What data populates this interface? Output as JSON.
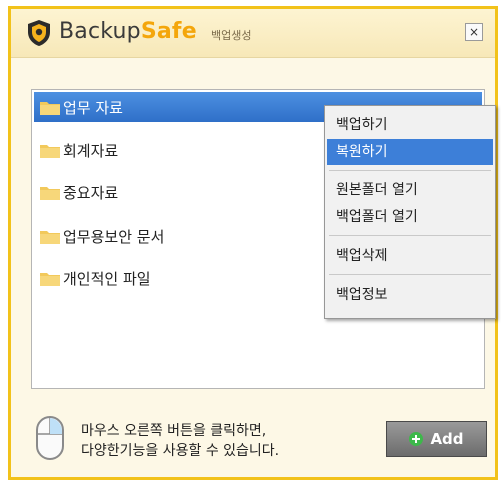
{
  "window": {
    "brand_part1": "Backup",
    "brand_part2": "Safe",
    "subtitle": "백업생성",
    "close_label": "×"
  },
  "folders": [
    {
      "name": "업무 자료",
      "selected": true
    },
    {
      "name": "회계자료",
      "selected": false
    },
    {
      "name": "중요자료",
      "selected": false
    },
    {
      "name": "업무용보안 문서",
      "selected": false
    },
    {
      "name": "개인적인 파일",
      "selected": false
    }
  ],
  "context_menu": {
    "items": [
      {
        "label": "백업하기",
        "highlighted": false
      },
      {
        "label": "복원하기",
        "highlighted": true
      },
      {
        "label": "원본폴더 열기",
        "highlighted": false
      },
      {
        "label": "백업폴더 열기",
        "highlighted": false
      },
      {
        "label": "백업삭제",
        "highlighted": false
      },
      {
        "label": "백업정보",
        "highlighted": false
      }
    ]
  },
  "footer": {
    "hint_line1": "마우스 오른쪽 버튼을 클릭하면,",
    "hint_line2": "다양한기능을 사용할 수 있습니다.",
    "add_label": "Add"
  },
  "icons": {
    "logo": "shield-icon",
    "folder": "folder-icon",
    "mouse": "mouse-icon",
    "add": "plus-icon"
  },
  "colors": {
    "brand_accent": "#f4a60b",
    "window_border": "#f2c21a",
    "selection": "#3d7fd8"
  }
}
